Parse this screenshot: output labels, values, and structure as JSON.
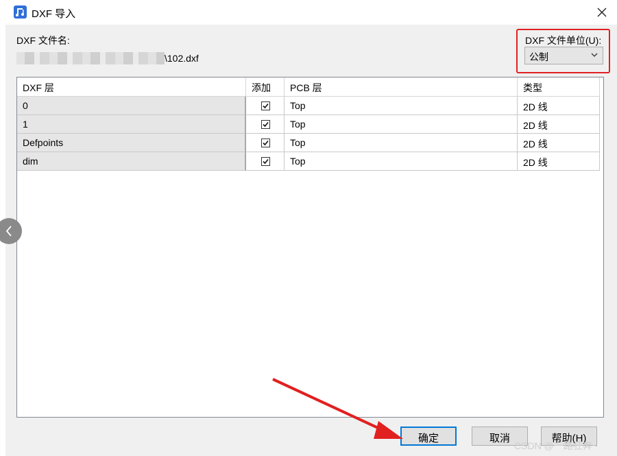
{
  "window": {
    "title": "DXF 导入",
    "close_glyph": "✕"
  },
  "file": {
    "label": "DXF 文件名:",
    "path_tail": "\\102.dxf"
  },
  "units": {
    "label": "DXF 文件单位(U):",
    "selected": "公制"
  },
  "grid": {
    "headers": [
      "DXF 层",
      "添加",
      "PCB 层",
      "类型"
    ],
    "rows": [
      {
        "dxf_layer": "0",
        "add": true,
        "pcb_layer": "Top",
        "type": "2D 线"
      },
      {
        "dxf_layer": "1",
        "add": true,
        "pcb_layer": "Top",
        "type": "2D 线"
      },
      {
        "dxf_layer": "Defpoints",
        "add": true,
        "pcb_layer": "Top",
        "type": "2D 线"
      },
      {
        "dxf_layer": "dim",
        "add": true,
        "pcb_layer": "Top",
        "type": "2D 线"
      }
    ]
  },
  "buttons": {
    "ok": "确定",
    "cancel": "取消",
    "help": "帮助(H)"
  },
  "watermark": "CSDN @一路狂奔~",
  "colors": {
    "highlight_red": "#e12020",
    "focus_blue": "#0078d7"
  }
}
